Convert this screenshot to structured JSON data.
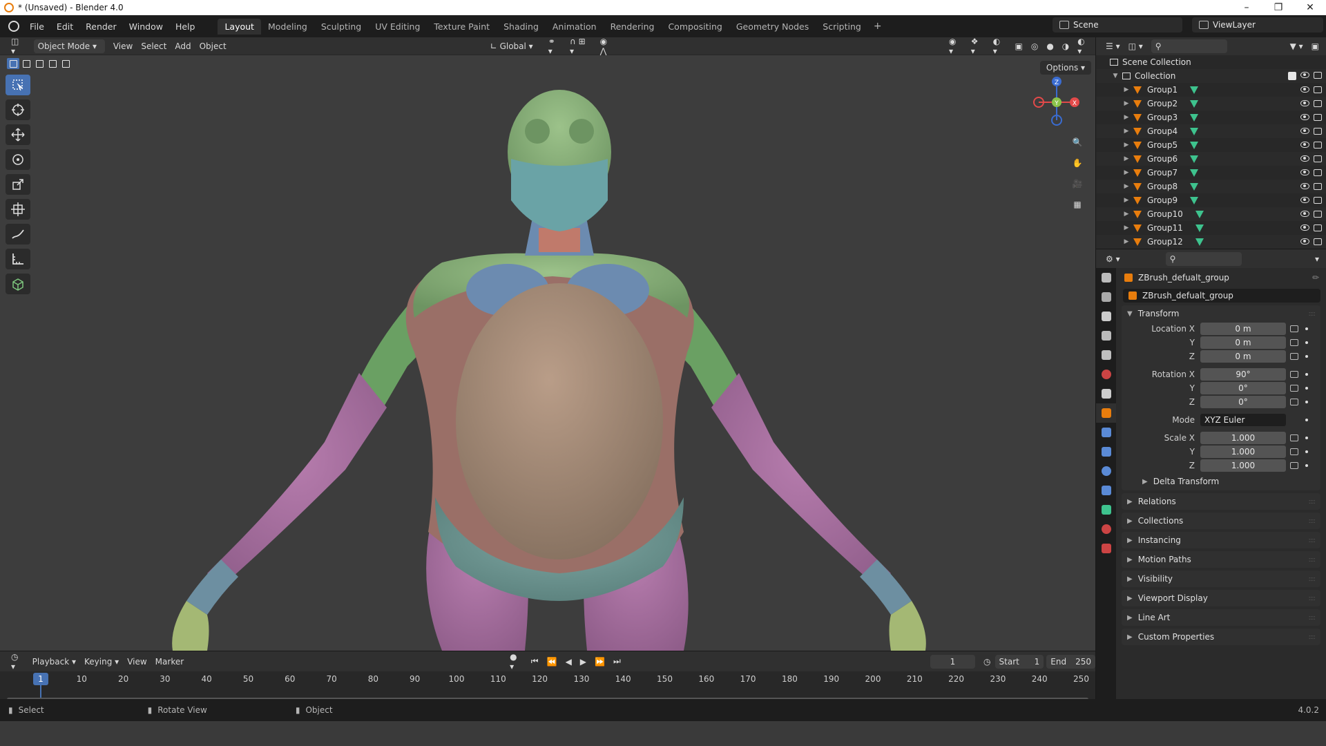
{
  "titlebar": {
    "title": "* (Unsaved) - Blender 4.0"
  },
  "menu": [
    "File",
    "Edit",
    "Render",
    "Window",
    "Help"
  ],
  "workspaces": [
    "Layout",
    "Modeling",
    "Sculpting",
    "UV Editing",
    "Texture Paint",
    "Shading",
    "Animation",
    "Rendering",
    "Compositing",
    "Geometry Nodes",
    "Scripting"
  ],
  "scene": {
    "name": "Scene",
    "view_layer": "ViewLayer"
  },
  "viewport_header": {
    "mode": "Object Mode",
    "view": "View",
    "select": "Select",
    "add": "Add",
    "object": "Object",
    "orientation": "Global",
    "options": "Options"
  },
  "gizmo": {
    "z": "Z",
    "y": "Y",
    "x": "X"
  },
  "outliner": {
    "scene_collection": "Scene Collection",
    "collection": "Collection",
    "groups": [
      "Group1",
      "Group2",
      "Group3",
      "Group4",
      "Group5",
      "Group6",
      "Group7",
      "Group8",
      "Group9",
      "Group10",
      "Group11",
      "Group12"
    ]
  },
  "properties": {
    "object_name": "ZBrush_defualt_group",
    "data_name": "ZBrush_defualt_group",
    "transform": {
      "title": "Transform",
      "location_label": "Location X",
      "location": [
        "0 m",
        "0 m",
        "0 m"
      ],
      "rotation_label": "Rotation X",
      "rotation": [
        "90°",
        "0°",
        "0°"
      ],
      "mode_label": "Mode",
      "mode": "XYZ Euler",
      "scale_label": "Scale X",
      "scale": [
        "1.000",
        "1.000",
        "1.000"
      ],
      "y": "Y",
      "z": "Z"
    },
    "delta_transform": "Delta Transform",
    "panels": [
      "Relations",
      "Collections",
      "Instancing",
      "Motion Paths",
      "Visibility",
      "Viewport Display",
      "Line Art",
      "Custom Properties"
    ]
  },
  "timeline": {
    "playback": "Playback",
    "keying": "Keying",
    "view": "View",
    "marker": "Marker",
    "current_frame": "1",
    "start_label": "Start",
    "start": "1",
    "end_label": "End",
    "end": "250",
    "ticks": [
      "10",
      "20",
      "30",
      "40",
      "50",
      "60",
      "70",
      "80",
      "90",
      "100",
      "110",
      "120",
      "130",
      "140",
      "150",
      "160",
      "170",
      "180",
      "190",
      "200",
      "210",
      "220",
      "230",
      "240",
      "250"
    ]
  },
  "status": {
    "select": "Select",
    "rotate": "Rotate View",
    "object": "Object",
    "version": "4.0.2"
  },
  "colors": {
    "accent": "#4772b3",
    "orange": "#e87d0d",
    "mesh_green": "#3ec38e"
  }
}
